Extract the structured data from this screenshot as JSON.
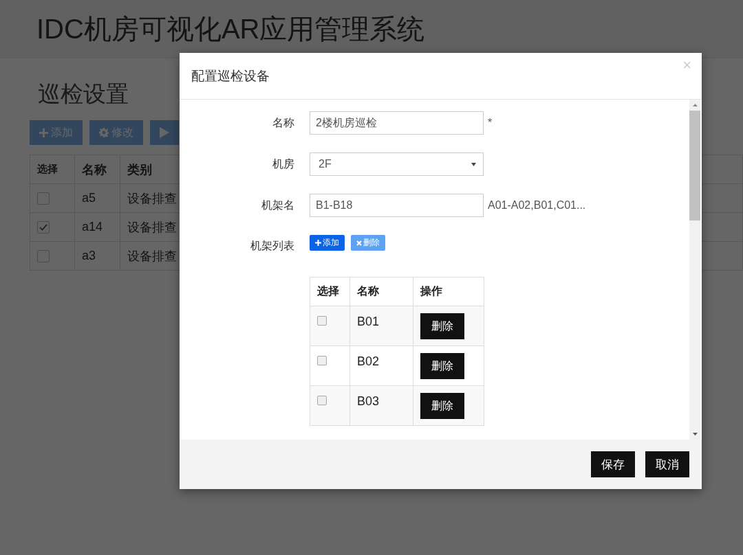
{
  "app_title": "IDC机房可视化AR应用管理系统",
  "page": {
    "title": "巡检设置",
    "toolbar": [
      {
        "kind": "add",
        "label": "添加"
      },
      {
        "kind": "edit",
        "label": "修改"
      },
      {
        "kind": "run"
      }
    ],
    "table": {
      "columns": [
        "选择",
        "名称",
        "类别"
      ],
      "rows": [
        {
          "checked": false,
          "name": "a5",
          "category": "设备排查"
        },
        {
          "checked": true,
          "name": "a14",
          "category": "设备排查"
        },
        {
          "checked": false,
          "name": "a3",
          "category": "设备排查"
        }
      ]
    }
  },
  "dialog": {
    "title": "配置巡检设备",
    "close": "×",
    "fields": [
      {
        "kind": "text",
        "label": "名称",
        "value": "2楼机房巡检",
        "note": "*"
      },
      {
        "kind": "select",
        "label": "机房",
        "value": "2F"
      },
      {
        "kind": "text",
        "label": "机架名",
        "value": "B1-B18",
        "note": "A01-A02,B01,C01..."
      }
    ],
    "rack_list": {
      "label": "机架列表",
      "actions": [
        {
          "label": "添加",
          "kind": "primary"
        },
        {
          "label": "删除",
          "kind": "secondary"
        }
      ],
      "columns": [
        "选择",
        "名称",
        "操作"
      ],
      "rows": [
        {
          "checked": false,
          "name": "B01",
          "action": "删除"
        },
        {
          "checked": false,
          "name": "B02",
          "action": "删除"
        },
        {
          "checked": false,
          "name": "B03",
          "action": "删除"
        }
      ]
    },
    "buttons": [
      "保存",
      "取消"
    ]
  }
}
